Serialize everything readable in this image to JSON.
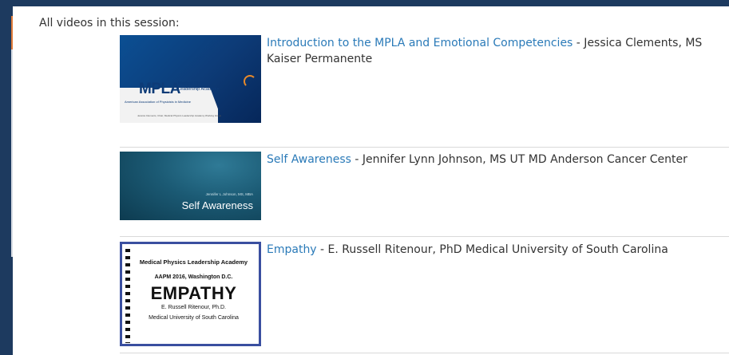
{
  "session": {
    "heading": "All videos in this session:"
  },
  "videos": [
    {
      "title": "Introduction to the MPLA and Emotional Competencies",
      "presenter": " - Jessica Clements, MS Kaiser Permanente",
      "thumbnail": {
        "logo": "MPLA",
        "logo_sub_1": "Medical Physics",
        "logo_sub_2": "Leadership Academy",
        "tagline": "American Association of Physicists in Medicine",
        "credit": "Jessica Clements, Chair, Medical Physics Leadership Academy Working Group",
        "accent_color": "#e88a2a"
      }
    },
    {
      "title": "Self Awareness",
      "presenter": " - Jennifer Lynn Johnson, MS UT MD Anderson Cancer Center",
      "thumbnail": {
        "name": "Jennifer L Johnson, MS, MBA",
        "title": "Self Awareness"
      }
    },
    {
      "title": "Empathy",
      "presenter": " - E. Russell Ritenour, PhD Medical University of South Carolina",
      "thumbnail": {
        "org": "Medical Physics Leadership Academy",
        "event": "AAPM 2016, Washington D.C.",
        "big": "EMPATHY",
        "author": "E. Russell Ritenour, Ph.D.",
        "affil": "Medical University of South Carolina"
      }
    }
  ],
  "colors": {
    "frame": "#1d3a5f",
    "link": "#2a7ab8",
    "text": "#333333"
  }
}
